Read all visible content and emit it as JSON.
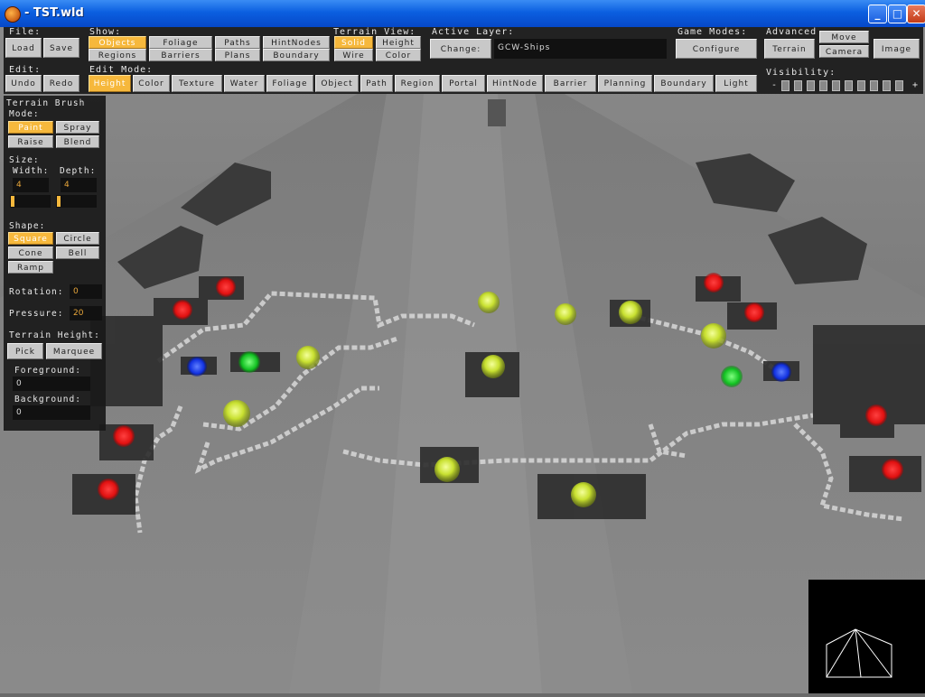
{
  "window": {
    "title": "- TST.wld",
    "min_label": "_",
    "max_label": "□",
    "close_label": "✕"
  },
  "toolbar": {
    "file": {
      "label": "File:",
      "load": "Load",
      "save": "Save"
    },
    "show": {
      "label": "Show:",
      "items": [
        "Objects",
        "Foliage",
        "Paths",
        "HintNodes",
        "Regions",
        "Barriers",
        "Plans",
        "Boundary"
      ]
    },
    "terrain_view": {
      "label": "Terrain View:",
      "items": [
        "Solid",
        "Height",
        "Wire",
        "Color"
      ]
    },
    "active_layer": {
      "label": "Active Layer:",
      "change": "Change:",
      "value": "GCW-Ships"
    },
    "game_modes": {
      "label": "Game Modes:",
      "configure": "Configure"
    },
    "advanced": {
      "label": "Advanced",
      "terrain": "Terrain",
      "move": "Move",
      "camera": "Camera",
      "image": "Image"
    },
    "edit": {
      "label": "Edit:",
      "undo": "Undo",
      "redo": "Redo"
    },
    "edit_mode": {
      "label": "Edit Mode:",
      "items": [
        "Height",
        "Color",
        "Texture",
        "Water",
        "Foliage",
        "Object",
        "Path",
        "Region",
        "Portal",
        "HintNode",
        "Barrier",
        "Planning",
        "Boundary",
        "Light"
      ]
    },
    "visibility": {
      "label": "Visibility:",
      "minus": "-",
      "plus": "+"
    }
  },
  "terrain_brush": {
    "title": "Terrain Brush",
    "mode_label": "Mode:",
    "paint": "Paint",
    "spray": "Spray",
    "raise": "Raise",
    "blend": "Blend",
    "size_label": "Size:",
    "width_label": "Width:",
    "depth_label": "Depth:",
    "width": "4",
    "depth": "4",
    "shape_label": "Shape:",
    "square": "Square",
    "circle": "Circle",
    "cone": "Cone",
    "bell": "Bell",
    "ramp": "Ramp",
    "rotation_label": "Rotation:",
    "rotation": "0",
    "pressure_label": "Pressure:",
    "pressure": "20",
    "terrain_height_label": "Terrain Height:",
    "pick": "Pick",
    "marquee": "Marquee",
    "foreground_label": "Foreground:",
    "foreground": "0",
    "background_label": "Background:",
    "background": "0"
  },
  "colors": {
    "accent": "#f6b83c",
    "toolbar_bg": "#222222",
    "button": "#c8c8c8"
  }
}
